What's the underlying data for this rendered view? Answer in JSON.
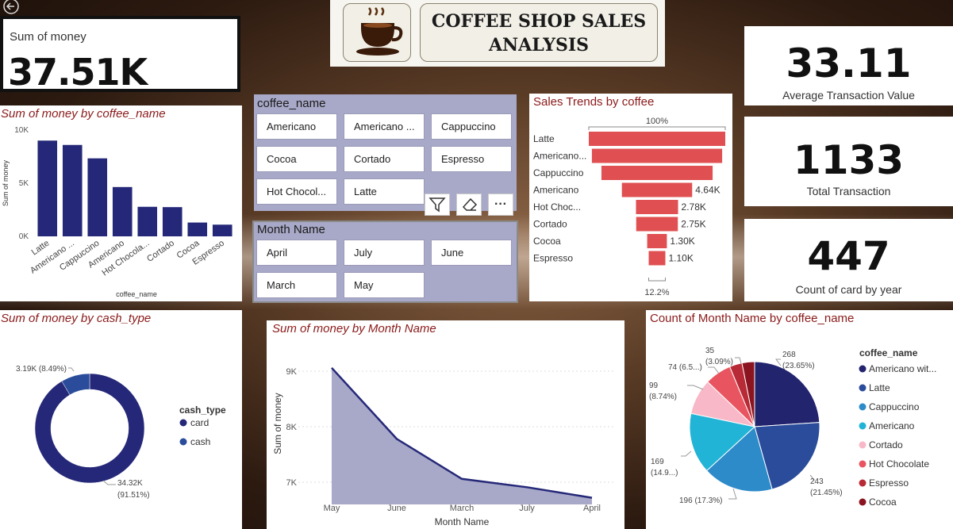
{
  "header": {
    "title_line1": "COFFEE SHOP SALES",
    "title_line2": "ANALYSIS",
    "logo_icon": "coffee-cup-icon"
  },
  "nav": {
    "back_icon": "back-arrow-icon"
  },
  "kpis": {
    "sum_money": {
      "label": "Sum of money",
      "value": "37.51K"
    },
    "avg_transaction": {
      "label": "Average Transaction Value",
      "value": "33.11"
    },
    "total_transaction": {
      "label": "Total Transaction",
      "value": "1133"
    },
    "card_count": {
      "label": "Count of card by year",
      "value": "447"
    }
  },
  "slicer_coffee": {
    "title": "coffee_name",
    "options": [
      "Americano",
      "Americano ...",
      "Cappuccino",
      "Cocoa",
      "Cortado",
      "Espresso",
      "Hot Chocol...",
      "Latte"
    ]
  },
  "slicer_month": {
    "title": "Month Name",
    "options": [
      "April",
      "July",
      "June",
      "March",
      "May"
    ]
  },
  "toolbar": {
    "filter_icon": "filter-icon",
    "eraser_icon": "eraser-icon",
    "more_label": "···"
  },
  "colors": {
    "navy": "#252878",
    "funnel": "#e05052",
    "area": "#a8a8c8",
    "title_red": "#8b1a1a",
    "pie": [
      "#22246e",
      "#2a4c9a",
      "#2e8bc9",
      "#22b4d6",
      "#f8b8c8",
      "#e85560",
      "#b82a35",
      "#8a1420"
    ]
  },
  "chart_data": [
    {
      "id": "bar_coffee",
      "type": "bar",
      "title": "Sum of money by coffee_name",
      "xlabel": "coffee_name",
      "ylabel": "Sum of money",
      "ylim": [
        0,
        10000
      ],
      "yticks": [
        "0K",
        "5K",
        "10K"
      ],
      "categories": [
        "Latte",
        "Americano ...",
        "Cappuccino",
        "Americano",
        "Hot Chocola...",
        "Cortado",
        "Cocoa",
        "Espresso"
      ],
      "values": [
        9010,
        8600,
        7340,
        4640,
        2780,
        2750,
        1300,
        1100
      ]
    },
    {
      "id": "funnel_sales",
      "type": "bar",
      "title": "Sales Trends by coffee",
      "top_label": "100%",
      "bottom_label": "12.2%",
      "categories": [
        "Latte",
        "Americano...",
        "Cappuccino",
        "Americano",
        "Hot Choc...",
        "Cortado",
        "Cocoa",
        "Espresso"
      ],
      "values": [
        9010,
        8600,
        7340,
        4640,
        2780,
        2750,
        1300,
        1100
      ],
      "value_labels": [
        "",
        "",
        "",
        "4.64K",
        "2.78K",
        "2.75K",
        "1.30K",
        "1.10K"
      ]
    },
    {
      "id": "donut_cash",
      "type": "pie",
      "title": "Sum of money by cash_type",
      "legend_title": "cash_type",
      "labels": [
        "card",
        "cash"
      ],
      "values": [
        34.32,
        3.19
      ],
      "data_labels": [
        [
          "34.32K",
          "(91.51%)"
        ],
        [
          "3.19K (8.49%)"
        ]
      ],
      "colors": [
        "#252878",
        "#2a4c9a"
      ]
    },
    {
      "id": "area_month",
      "type": "area",
      "title": "Sum of money by Month Name",
      "xlabel": "Month Name",
      "ylabel": "Sum of money",
      "categories": [
        "May",
        "June",
        "March",
        "July",
        "April"
      ],
      "values": [
        9060,
        7780,
        7060,
        6910,
        6720
      ],
      "ylim": [
        6600,
        9200
      ],
      "yticks": [
        {
          "v": 7000,
          "label": "7K"
        },
        {
          "v": 8000,
          "label": "8K"
        },
        {
          "v": 9000,
          "label": "9K"
        }
      ]
    },
    {
      "id": "pie_month",
      "type": "pie",
      "title": "Count of Month Name by coffee_name",
      "legend_title": "coffee_name",
      "labels": [
        "Americano wit...",
        "Latte",
        "Cappuccino",
        "Americano",
        "Cortado",
        "Hot Chocolate",
        "Espresso",
        "Cocoa"
      ],
      "values": [
        268,
        243,
        196,
        169,
        99,
        74,
        35,
        35
      ],
      "data_labels": [
        [
          "268",
          "(23.65%)"
        ],
        [
          "243",
          "(21.45%)"
        ],
        [
          "196 (17.3%)"
        ],
        [
          "169",
          "(14.9...)"
        ],
        [
          "99",
          "(8.74%)"
        ],
        [
          "74 (6.5...)"
        ],
        [
          "35",
          "(3.09%)"
        ],
        []
      ]
    }
  ]
}
